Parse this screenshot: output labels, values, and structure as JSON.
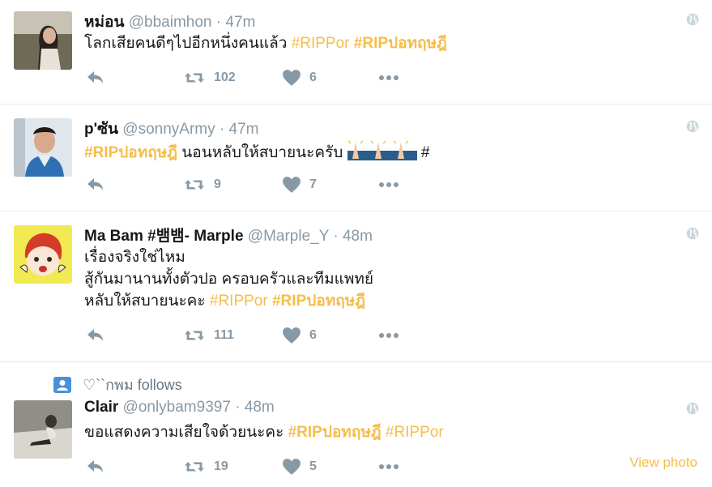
{
  "colors": {
    "hashtag": "#f5bd4a",
    "muted": "#8899a6",
    "text": "#14171a",
    "divider": "#e6ecf0"
  },
  "tweets": [
    {
      "name": "หม่อน",
      "handle": "@bbaimhon",
      "sep": "·",
      "time": "47m",
      "text_plain": "โลกเสียคนดีๆไปอีกหนึ่งคนแล้ว ",
      "tag1": "#RIPPor",
      "tag2": "#RIPปอทฤษฎี",
      "retweets": "102",
      "likes": "6"
    },
    {
      "name": "p'ซัน",
      "handle": "@sonnyArmy",
      "sep": "·",
      "time": "47m",
      "tag1": "#RIPปอทฤษฎี",
      "text_plain": " นอนหลับให้สบายนะครับ ",
      "trail": "#",
      "emoji": "folded-hands-emoji",
      "retweets": "9",
      "likes": "7"
    },
    {
      "name": "Ma Bam #뱀뱀- Marple",
      "handle": "@Marple_Y",
      "sep": "·",
      "time": "48m",
      "line1": "เรื่องจริงใช่ไหม",
      "line2": "สู้กันมานานทั้งตัวปอ ครอบครัวและทีมแพทย์",
      "line3": "หลับให้สบายนะคะ ",
      "tag1": "#RIPPor",
      "tag2": "#RIPปอทฤษฎี",
      "retweets": "111",
      "likes": "6"
    },
    {
      "follows": "♡``กพม follows",
      "name": "Clair",
      "handle": "@onlybam9397",
      "sep": "·",
      "time": "48m",
      "text_plain": "ขอแสดงความเสียใจด้วยนะคะ  ",
      "tag1": "#RIPปอทฤษฎี",
      "tag2": "#RIPPor",
      "retweets": "19",
      "likes": "5",
      "view_photo": "View photo"
    }
  ],
  "icons": [
    "reply-icon",
    "retweet-icon",
    "heart-icon",
    "more-icon",
    "globe-icon",
    "person-card-icon"
  ]
}
